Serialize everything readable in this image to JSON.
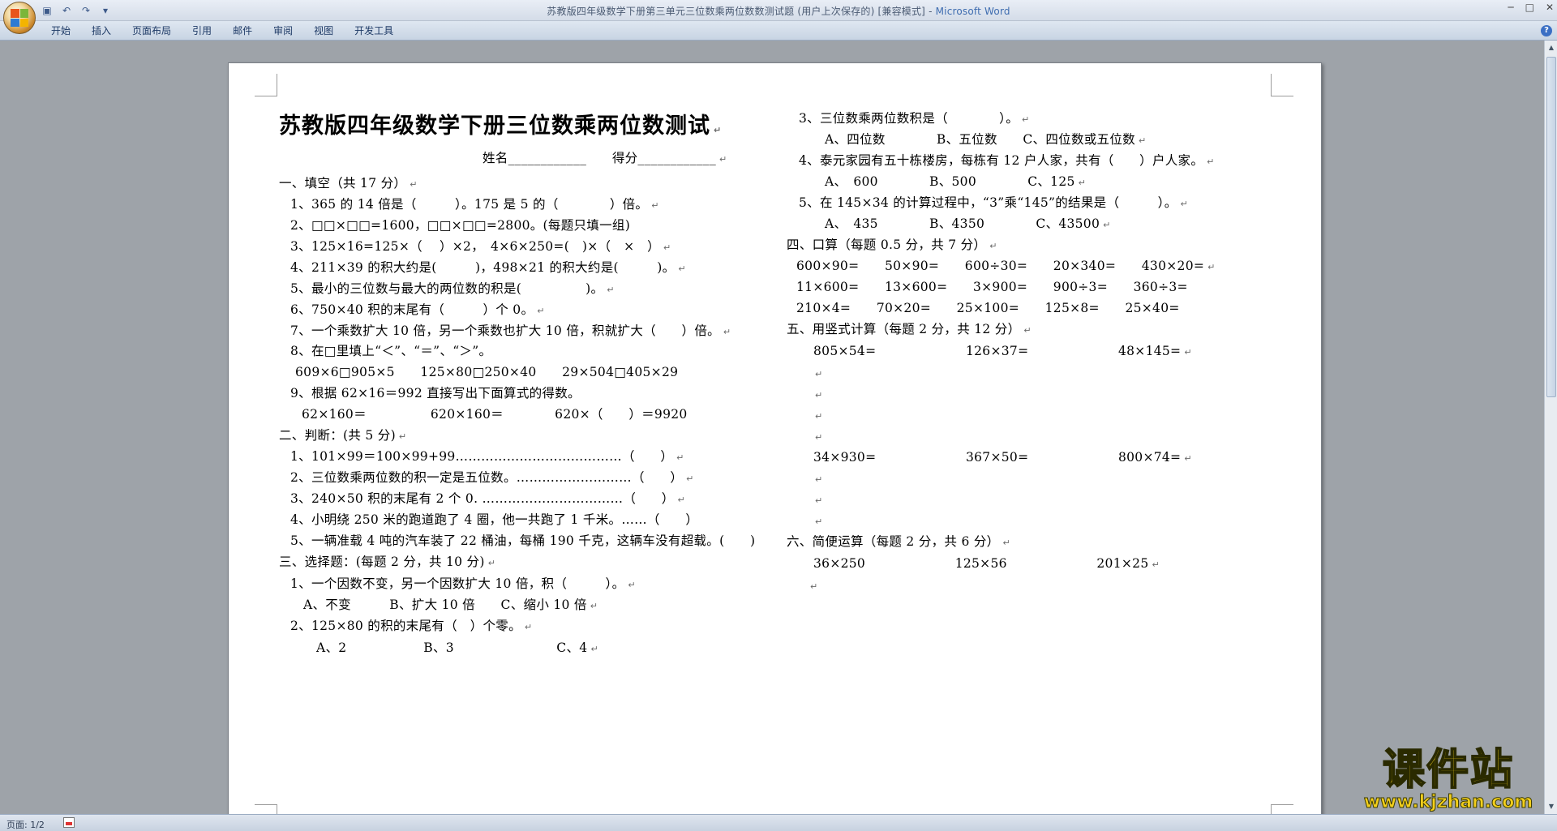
{
  "window": {
    "title_doc": "苏教版四年级数学下册第三单元三位数乘两位数数测试题 (用户上次保存的) [兼容模式] - ",
    "title_app": "Microsoft Word"
  },
  "qat": {
    "save_icon": "save-icon",
    "undo_icon": "undo-icon",
    "redo_icon": "redo-icon",
    "customize_icon": "dropdown-icon"
  },
  "ribbon": {
    "tabs": [
      "开始",
      "插入",
      "页面布局",
      "引用",
      "邮件",
      "审阅",
      "视图",
      "开发工具"
    ]
  },
  "document": {
    "title": "苏教版四年级数学下册三位数乘两位数测试",
    "name_line": "姓名____________",
    "score_line": "得分____________",
    "left": [
      "一、填空（共 17 分）",
      "1、365 的 14 倍是（　　　）。175 是 5 的（　　　　）倍。",
      "2、□□×□□=1600，□□×□□=2800。(每题只填一组)",
      "3、125×16=125×（　 ）×2，　4×6×250=(　)×（　×　）",
      "4、211×39 的积大约是(　　　)，498×21 的积大约是(　　　)。",
      "5、最小的三位数与最大的两位数的积是(　　　　　)。",
      "6、750×40 积的末尾有（　　　）个 0。",
      "7、一个乘数扩大 10 倍，另一个乘数也扩大 10 倍，积就扩大（　　）倍。",
      "8、在□里填上“＜”、“＝”、“＞”。",
      "609×6□905×5　　125×80□250×40　　29×504□405×29",
      "9、根据 62×16＝992 直接写出下面算式的得数。",
      "62×160＝　　　　　620×160＝　　　　620×（　　）＝9920",
      "二、判断：(共 5 分)",
      "1、101×99＝100×99+99…………………………………（　　）",
      "2、三位数乘两位数的积一定是五位数。………………………（　　）",
      "3、240×50 积的末尾有 2 个 0. ……………………………（　　）",
      "4、小明绕 250 米的跑道跑了 4 圈，他一共跑了 1 千米。……（　　）",
      "5、一辆准载 4 吨的汽车装了 22 桶油，每桶 190 千克，这辆车没有超载。(　　)",
      "三、选择题：(每题 2 分，共 10 分)",
      "1、一个因数不变，另一个因数扩大 10 倍，积（　　　）。",
      "A、不变　　　B、扩大 10 倍　　C、缩小 10 倍",
      "2、125×80 的积的末尾有（　）个零。",
      "A、2　　　　　　B、3　　　　　　　　C、4"
    ],
    "right": [
      "3、三位数乘两位数积是（　　　　）。",
      "A、四位数　　　　B、五位数　　C、四位数或五位数",
      "4、泰元家园有五十栋楼房，每栋有 12 户人家，共有（　　）户人家。",
      "A、　600　　　　B、500　　　　C、125",
      "5、在 145×34 的计算过程中，“3”乘“145”的结果是（　　　）。",
      "A、　435　　　　B、4350　　　　C、43500",
      "四、口算（每题 0.5 分，共 7 分）",
      "600×90=　　50×90=　　600÷30=　　20×340=　　430×20=",
      "11×600=　　13×600=　　3×900=　　900÷3=　　360÷3=",
      "210×4=　　70×20=　　25×100=　　125×8=　　25×40=",
      "五、用竖式计算（每题 2 分，共 12 分）",
      "805×54=　　　　　　　126×37=　　　　　　　48×145=",
      "34×930=　　　　　　　367×50=　　　　　　　800×74=",
      "六、简便运算（每题 2 分，共 6 分）",
      "36×250　　　　　　　125×56　　　　　　　201×25"
    ],
    "paragraph_mark": "↵"
  },
  "status": {
    "page": "页面: 1/2"
  },
  "watermark": {
    "main": "课件站",
    "url": "www.kjzhan.com"
  }
}
